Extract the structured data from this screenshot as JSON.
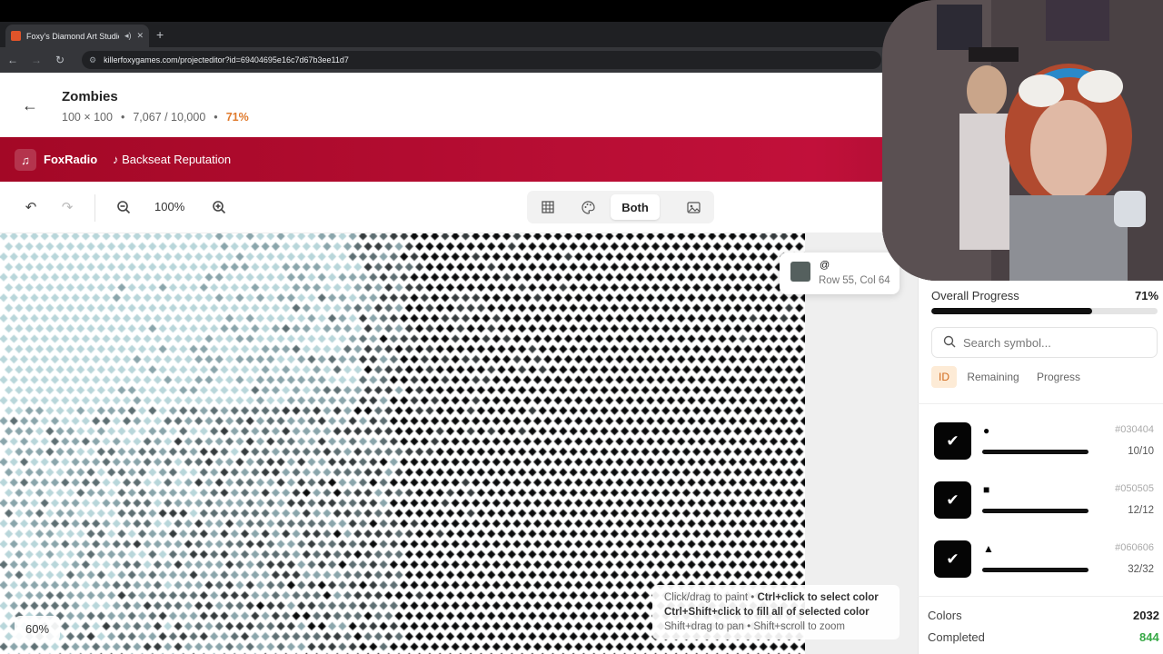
{
  "browser": {
    "tab_title": "Foxy's Diamond Art Studio",
    "audio_icon": "speaker-icon",
    "url_text": "killerfoxygames.com/projecteditor?id=69404695e16c7d67b3ee11d7"
  },
  "project": {
    "title": "Zombies",
    "dimensions": "100 × 100",
    "separator": "•",
    "progress_text": "7,067 / 10,000",
    "percent": "71%"
  },
  "radio": {
    "name": "FoxRadio",
    "song": "♪ Backseat Reputation",
    "icon": "music-note-icon"
  },
  "toolbar": {
    "zoom_label": "100%",
    "view_modes": [
      "grid-icon",
      "palette-icon",
      "Both",
      "image-icon"
    ],
    "active_view": "Both"
  },
  "canvas": {
    "tooltip_symbol": "@",
    "tooltip_location": "Row 55, Col 64",
    "tooltip_color": "#55605e",
    "hint_line1_a": "Click/drag to paint • ",
    "hint_line1_b": "Ctrl+click to select color",
    "hint_line2": "Ctrl+Shift+click to fill all of selected color",
    "hint_line3": "Shift+drag to pan • Shift+scroll to zoom",
    "zoom_chip": "60%"
  },
  "panel": {
    "overall_label": "Overall Progress",
    "overall_percent": "71%",
    "overall_fraction": 0.71,
    "search_placeholder": "Search symbol...",
    "sort_tabs": [
      "ID",
      "Remaining",
      "Progress"
    ],
    "active_sort": "ID",
    "colors": [
      {
        "symbol": "●",
        "hex": "#030404",
        "count": "10/10",
        "progress": 1.0
      },
      {
        "symbol": "■",
        "hex": "#050505",
        "count": "12/12",
        "progress": 1.0
      },
      {
        "symbol": "▲",
        "hex": "#060606",
        "count": "32/32",
        "progress": 1.0
      }
    ],
    "stats": {
      "colors_label": "Colors",
      "colors_value": "2032",
      "completed_label": "Completed",
      "completed_value": "844"
    }
  },
  "colors": {
    "accent": "#e07a2c",
    "radio_bar": "#b30c30",
    "complete_green": "#36a845"
  }
}
